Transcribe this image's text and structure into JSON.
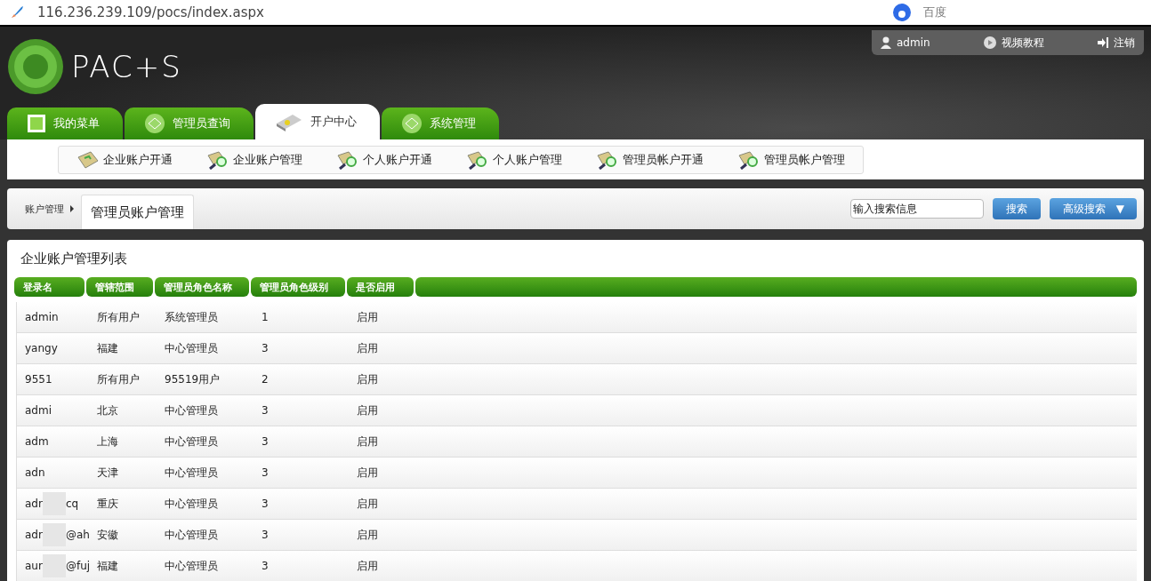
{
  "browser": {
    "url": "116.236.239.109/pocs/index.aspx",
    "search_engine": "百度"
  },
  "header": {
    "logo_text": "PAC+S",
    "user": "admin",
    "video_link": "视频教程",
    "logout": "注销"
  },
  "tabs": [
    {
      "label": "我的菜单",
      "selected": false
    },
    {
      "label": "管理员查询",
      "selected": false
    },
    {
      "label": "开户中心",
      "selected": true
    },
    {
      "label": "系统管理",
      "selected": false
    }
  ],
  "submenu": [
    "企业账户开通",
    "企业账户管理",
    "个人账户开通",
    "个人账户管理",
    "管理员帐户开通",
    "管理员帐户管理"
  ],
  "breadcrumb": {
    "parent": "账户管理",
    "current": "管理员账户管理"
  },
  "search": {
    "value": "输入搜索信息",
    "button": "搜索",
    "advanced": "高级搜索",
    "advanced_caret": "▼"
  },
  "table": {
    "title": "企业账户管理列表",
    "columns": [
      "登录名",
      "管辖范围",
      "管理员角色名称",
      "管理员角色级别",
      "是否启用"
    ],
    "rows": [
      {
        "login": [
          "admin"
        ],
        "scope": "所有用户",
        "role": "系统管理员",
        "level": "1",
        "enabled": "启用"
      },
      {
        "login": [
          "yangy"
        ],
        "scope": "福建",
        "role": "中心管理员",
        "level": "3",
        "enabled": "启用"
      },
      {
        "login": [
          "9551"
        ],
        "scope": "所有用户",
        "role": "95519用户",
        "level": "2",
        "enabled": "启用"
      },
      {
        "login": [
          "admi"
        ],
        "scope": "北京",
        "role": "中心管理员",
        "level": "3",
        "enabled": "启用"
      },
      {
        "login": [
          "adm"
        ],
        "scope": "上海",
        "role": "中心管理员",
        "level": "3",
        "enabled": "启用"
      },
      {
        "login": [
          "adn"
        ],
        "scope": "天津",
        "role": "中心管理员",
        "level": "3",
        "enabled": "启用"
      },
      {
        "login": [
          "adr",
          "cq"
        ],
        "scope": "重庆",
        "role": "中心管理员",
        "level": "3",
        "enabled": "启用"
      },
      {
        "login": [
          "adr",
          "@ah"
        ],
        "scope": "安徽",
        "role": "中心管理员",
        "level": "3",
        "enabled": "启用"
      },
      {
        "login": [
          "aur",
          "@fuj"
        ],
        "scope": "福建",
        "role": "中心管理员",
        "level": "3",
        "enabled": "启用"
      }
    ]
  }
}
